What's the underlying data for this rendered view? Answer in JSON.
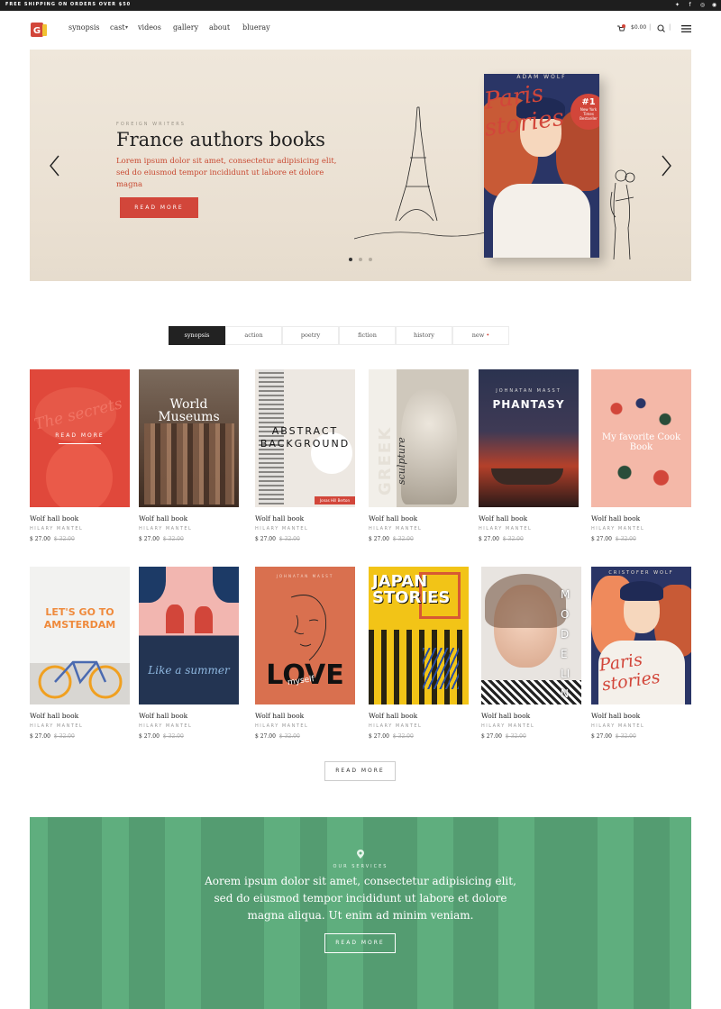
{
  "topbar": {
    "shipping": "FREE SHIPPING ON ORDERS OVER $50",
    "social_icons": [
      "twitter-icon",
      "facebook-icon",
      "instagram-icon",
      "youtube-icon",
      "rss-icon"
    ]
  },
  "header": {
    "logo_letter": "G",
    "nav": [
      "synopsis",
      "cast",
      "videos",
      "gallery",
      "about",
      "blueray"
    ],
    "cart_total": "$0.00",
    "cart_count": "0"
  },
  "hero": {
    "eyebrow": "FOREIGN WRITERS",
    "title": "France authors books",
    "description": "Lorem ipsum dolor sit amet, consectetur adipisicing elit, sed do eiusmod tempor incididunt ut labore et dolore magna",
    "button": "READ MORE",
    "book": {
      "author": "ADAM WOLF",
      "title_line1": "Paris",
      "title_line2": "stories",
      "badge_rank": "#1",
      "badge_text": "New York Times Bestseller"
    }
  },
  "tabs": [
    {
      "label": "synopsis",
      "active": true
    },
    {
      "label": "action",
      "active": false
    },
    {
      "label": "poetry",
      "active": false
    },
    {
      "label": "fiction",
      "active": false
    },
    {
      "label": "history",
      "active": false
    },
    {
      "label": "new",
      "active": false,
      "marker": "•"
    }
  ],
  "books": [
    {
      "name": "Wolf hall book",
      "author": "HILARY MANTEL",
      "price": "$ 27.00",
      "old_price": "$ 32.00",
      "cover": {
        "bg": "#e0483b",
        "title": "The secrets",
        "overlay": "READ MORE"
      }
    },
    {
      "name": "Wolf hall book",
      "author": "HILARY MANTEL",
      "price": "$ 27.00",
      "old_price": "$ 32.00",
      "cover": {
        "bg": "#6b5446",
        "title": "World Museums"
      }
    },
    {
      "name": "Wolf hall book",
      "author": "HILARY MANTEL",
      "price": "$ 27.00",
      "old_price": "$ 32.00",
      "cover": {
        "bg": "#ede8e2",
        "title": "ABSTRACT BACKGROUND",
        "tag": "Jonas Hill Berton"
      }
    },
    {
      "name": "Wolf hall book",
      "author": "HILARY MANTEL",
      "price": "$ 27.00",
      "old_price": "$ 32.00",
      "cover": {
        "bg": "#c8c2b8",
        "title": "GREEK",
        "subtitle": "sculpture"
      }
    },
    {
      "name": "Wolf hall book",
      "author": "HILARY MANTEL",
      "price": "$ 27.00",
      "old_price": "$ 32.00",
      "cover": {
        "bg": "#2e3a52",
        "title": "PHANTASY",
        "author": "JOHNATAN MASST"
      }
    },
    {
      "name": "Wolf hall book",
      "author": "HILARY MANTEL",
      "price": "$ 27.00",
      "old_price": "$ 32.00",
      "cover": {
        "bg": "#f4b8a8",
        "title": "My favorite Cook Book"
      }
    },
    {
      "name": "Wolf hall book",
      "author": "HILARY MANTEL",
      "price": "$ 27.00",
      "old_price": "$ 32.00",
      "cover": {
        "bg": "#f2f2f0",
        "title": "LET'S GO TO AMSTERDAM"
      }
    },
    {
      "name": "Wolf hall book",
      "author": "HILARY MANTEL",
      "price": "$ 27.00",
      "old_price": "$ 32.00",
      "cover": {
        "bg": "#f2b6b0",
        "title": "Like a summer"
      }
    },
    {
      "name": "Wolf hall book",
      "author": "HILARY MANTEL",
      "price": "$ 27.00",
      "old_price": "$ 32.00",
      "cover": {
        "bg": "#d9704f",
        "title": "LOVE",
        "subtitle": "myself",
        "author": "JOHNATAN MASST"
      }
    },
    {
      "name": "Wolf hall book",
      "author": "HILARY MANTEL",
      "price": "$ 27.00",
      "old_price": "$ 32.00",
      "cover": {
        "bg": "#f2c417",
        "title": "JAPAN STORIES"
      }
    },
    {
      "name": "Wolf hall book",
      "author": "HILARY MANTEL",
      "price": "$ 27.00",
      "old_price": "$ 32.00",
      "cover": {
        "bg": "#e8e4e0",
        "title": "MODELING"
      }
    },
    {
      "name": "Wolf hall book",
      "author": "HILARY MANTEL",
      "price": "$ 27.00",
      "old_price": "$ 32.00",
      "cover": {
        "bg": "#ef8a5c",
        "title": "Paris stories",
        "author": "CRISTOFER WOLF"
      }
    }
  ],
  "load_more": "READ MORE",
  "services": {
    "eyebrow": "OUR SERVICES",
    "text": "Aorem ipsum dolor sit amet, consectetur adipisicing elit, sed do eiusmod tempor incididunt ut labore et dolore magna aliqua. Ut enim ad minim veniam.",
    "button": "READ MORE"
  },
  "colors": {
    "accent": "#d2463a",
    "dark": "#222222",
    "services_bg": "#5fae7e"
  }
}
